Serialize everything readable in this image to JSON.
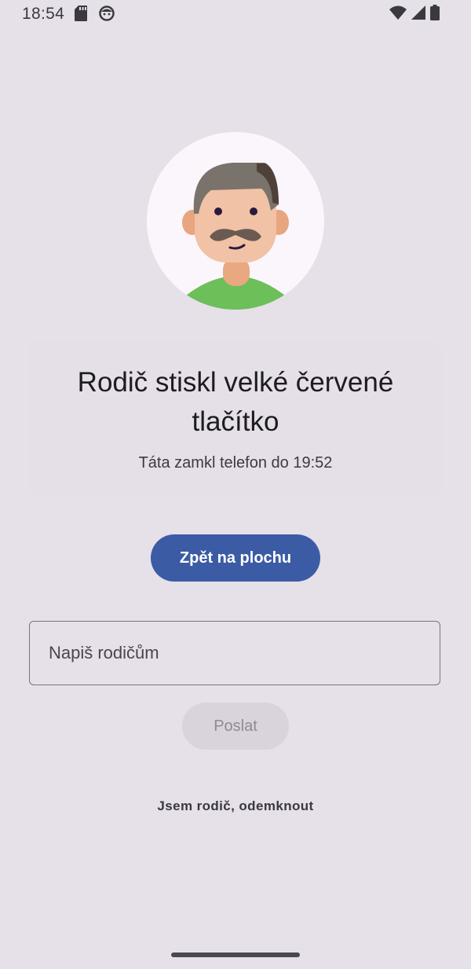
{
  "status_bar": {
    "time": "18:54",
    "left_icons": [
      "sd-card-icon",
      "face-icon"
    ],
    "right_icons": [
      "wifi-icon",
      "cellular-signal-icon",
      "battery-icon"
    ]
  },
  "avatar": {
    "icon": "father-avatar-icon",
    "colors": {
      "background": "#fbf6fb",
      "hair": "#7a736b",
      "skin": "#f1c2a5",
      "ear": "#e8a57f",
      "neck": "#e9a87f",
      "mustache": "#6b5a52",
      "shirt": "#6cbf59"
    }
  },
  "main": {
    "title": "Rodič stiskl velké červené tlačítko",
    "subtitle": "Táta zamkl telefon do 19:52"
  },
  "actions": {
    "home_button_label": "Zpět na plochu",
    "message_placeholder": "Napiš rodičům",
    "message_value": "",
    "send_button_label": "Poslat",
    "unlock_link_label": "Jsem rodič, odemknout"
  },
  "colors": {
    "background": "#e6e0e9",
    "primary": "#3b5ba5",
    "disabled_button": "#d9d4dc"
  }
}
